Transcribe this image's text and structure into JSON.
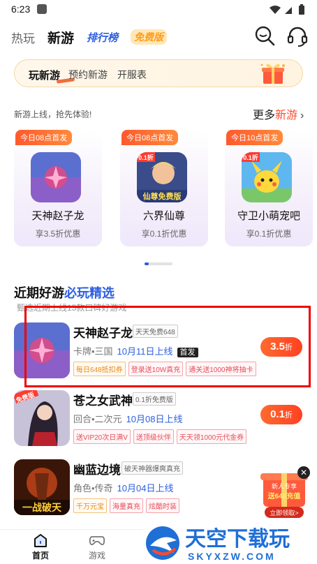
{
  "status": {
    "time": "6:23",
    "icons": "▾◢▮"
  },
  "top_tabs": [
    "热玩",
    "新游",
    "排行榜",
    "免费版"
  ],
  "sub_tabs": [
    "玩新游",
    "预约新游",
    "开服表"
  ],
  "new_section": {
    "subtitle": "新游上线，抢先体验!",
    "more_prefix": "更多",
    "more_highlight": "新游",
    "more_chevron": "›"
  },
  "cards": [
    {
      "tag": "今日08点首发",
      "name": "天神赵子龙",
      "discount": "享3.5折优惠"
    },
    {
      "tag": "今日08点首发",
      "name": "六界仙尊",
      "discount": "享0.1折优惠"
    },
    {
      "tag": "今日10点首发",
      "name": "守卫小萌宠吧",
      "discount": "享0.1折优惠"
    }
  ],
  "recent_section": {
    "title_plain": "近期好游",
    "title_highlight": "必玩精选",
    "subtitle": "甄选近期上线15款口碑好游戏"
  },
  "rows": [
    {
      "title": "天神赵子龙",
      "badge": "天天免费648",
      "genre": "卡牌•三国",
      "date": "10月11日上线",
      "first": "首发",
      "tags": [
        "每日648抵扣券",
        "登录送10W真充",
        "通关送1000神将抽卡"
      ],
      "disc_value": "3.5",
      "disc_unit": "折"
    },
    {
      "title": "苍之女武神",
      "badge": "0.1折免费版",
      "genre": "回合•二次元",
      "date": "10月08日上线",
      "tags": [
        "送VIP20次日满V",
        "送顶级伙伴",
        "天天领1000元代金券"
      ],
      "disc_value": "0.1",
      "disc_unit": "折"
    },
    {
      "title": "幽蓝边境",
      "badge": "破天神器爆爽真充",
      "genre": "角色•传奇",
      "date": "10月04日上线",
      "tags": [
        "千万元宝",
        "海量真充",
        "炫酷时装"
      ]
    }
  ],
  "thumb_texts": {
    "card2_label": "仙尊免费版",
    "card2_badge": "0.1折",
    "card3_badge": "0.1折",
    "row2_label": "免费版",
    "row3_label": "一战破天"
  },
  "promo": {
    "line1": "新人专享",
    "line2": "送648充值",
    "line3": "立即领取>",
    "close": "✕"
  },
  "nav": [
    "首页",
    "游戏"
  ],
  "watermark": {
    "cn": "天空下载玩",
    "en": "SKYXZW.COM"
  },
  "colors": {
    "accent_blue": "#2c5fe0",
    "accent_orange": "#ff4b2f",
    "highlight_box": "#ee0000"
  }
}
